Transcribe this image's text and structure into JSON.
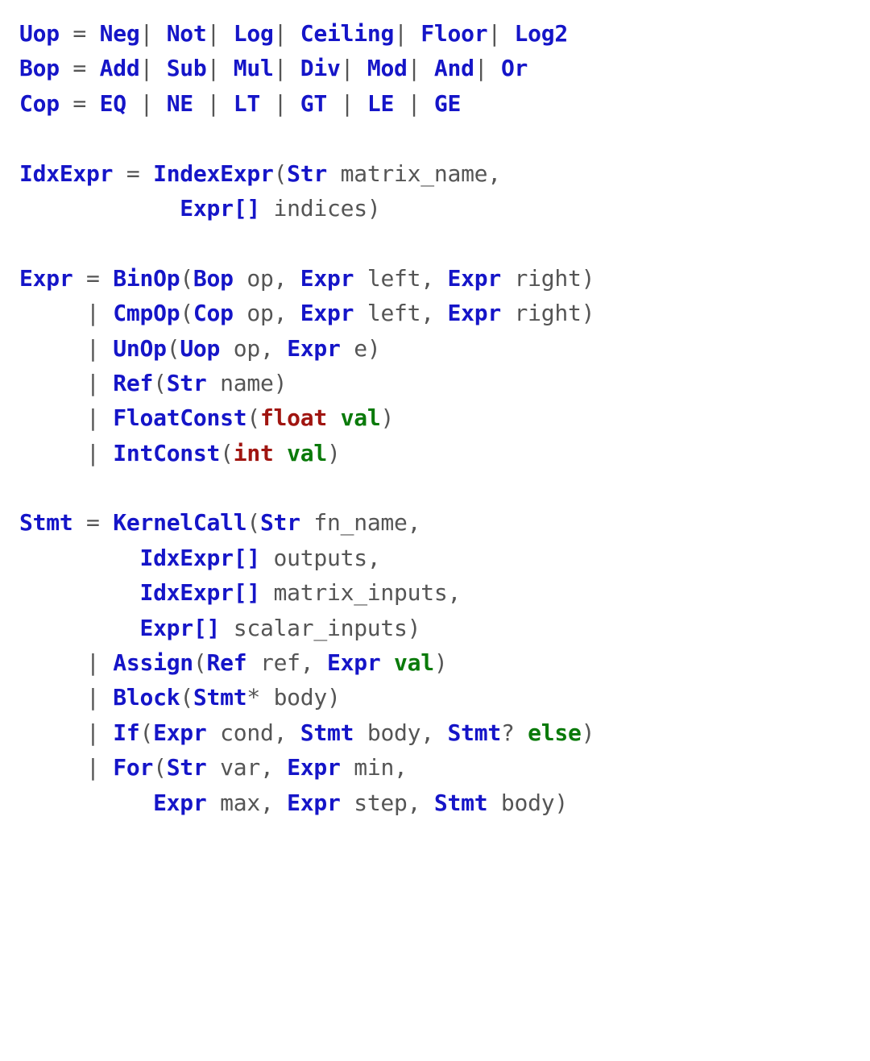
{
  "grammar": {
    "Uop": {
      "alts": [
        "Neg",
        "Not",
        "Log",
        "Ceiling",
        "Floor",
        "Log2"
      ]
    },
    "Bop": {
      "alts": [
        "Add",
        "Sub",
        "Mul",
        "Div",
        "Mod",
        "And",
        "Or"
      ]
    },
    "Cop": {
      "alts": [
        "EQ",
        "NE",
        "LT",
        "GT",
        "LE",
        "GE"
      ]
    },
    "IdxExpr": {
      "ctor": "IndexExpr",
      "params": [
        {
          "type": "Str",
          "name": "matrix_name"
        },
        {
          "type": "Expr[]",
          "name": "indices"
        }
      ]
    },
    "Expr": {
      "alts": [
        {
          "ctor": "BinOp",
          "params": [
            {
              "type": "Bop",
              "name": "op"
            },
            {
              "type": "Expr",
              "name": "left"
            },
            {
              "type": "Expr",
              "name": "right"
            }
          ]
        },
        {
          "ctor": "CmpOp",
          "params": [
            {
              "type": "Cop",
              "name": "op"
            },
            {
              "type": "Expr",
              "name": "left"
            },
            {
              "type": "Expr",
              "name": "right"
            }
          ]
        },
        {
          "ctor": "UnOp",
          "params": [
            {
              "type": "Uop",
              "name": "op"
            },
            {
              "type": "Expr",
              "name": "e"
            }
          ]
        },
        {
          "ctor": "Ref",
          "params": [
            {
              "type": "Str",
              "name": "name"
            }
          ]
        },
        {
          "ctor": "FloatConst",
          "params": [
            {
              "type": "float",
              "name": "val",
              "primitive": true
            }
          ]
        },
        {
          "ctor": "IntConst",
          "params": [
            {
              "type": "int",
              "name": "val",
              "primitive": true
            }
          ]
        }
      ]
    },
    "Stmt": {
      "alts": [
        {
          "ctor": "KernelCall",
          "params": [
            {
              "type": "Str",
              "name": "fn_name"
            },
            {
              "type": "IdxExpr[]",
              "name": "outputs"
            },
            {
              "type": "IdxExpr[]",
              "name": "matrix_inputs"
            },
            {
              "type": "Expr[]",
              "name": "scalar_inputs"
            }
          ]
        },
        {
          "ctor": "Assign",
          "params": [
            {
              "type": "Ref",
              "name": "ref"
            },
            {
              "type": "Expr",
              "name": "val",
              "id": true
            }
          ]
        },
        {
          "ctor": "Block",
          "params": [
            {
              "type": "Stmt*",
              "name": "body"
            }
          ]
        },
        {
          "ctor": "If",
          "params": [
            {
              "type": "Expr",
              "name": "cond"
            },
            {
              "type": "Stmt",
              "name": "body"
            },
            {
              "type": "Stmt?",
              "name": "else",
              "id": true
            }
          ]
        },
        {
          "ctor": "For",
          "params": [
            {
              "type": "Str",
              "name": "var"
            },
            {
              "type": "Expr",
              "name": "min"
            },
            {
              "type": "Expr",
              "name": "max"
            },
            {
              "type": "Expr",
              "name": "step"
            },
            {
              "type": "Stmt",
              "name": "body"
            }
          ]
        }
      ]
    }
  }
}
